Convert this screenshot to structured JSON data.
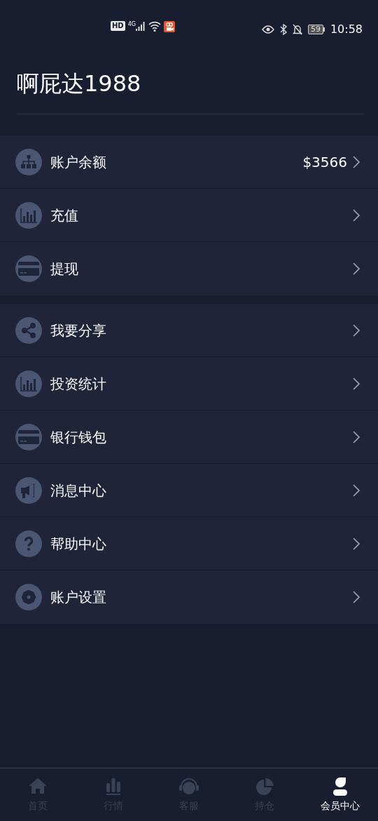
{
  "status_bar": {
    "hd_label": "HD",
    "network_label": "4G",
    "battery_label": "59",
    "time": "10:58"
  },
  "profile": {
    "username": "啊屁达1988"
  },
  "menu_groups": [
    {
      "items": [
        {
          "kind": "sitemap",
          "label": "账户余额",
          "value": "$3566"
        },
        {
          "kind": "chart",
          "label": "充值"
        },
        {
          "kind": "card",
          "label": "提现"
        }
      ]
    },
    {
      "items": [
        {
          "kind": "share",
          "label": "我要分享"
        },
        {
          "kind": "chart",
          "label": "投资统计"
        },
        {
          "kind": "card",
          "label": "银行钱包"
        },
        {
          "kind": "megaphone",
          "label": "消息中心"
        },
        {
          "kind": "help",
          "label": "帮助中心"
        },
        {
          "kind": "gear",
          "label": "账户设置"
        }
      ]
    }
  ],
  "bottom_nav": [
    {
      "kind": "home",
      "label": "首页",
      "selected": false
    },
    {
      "kind": "bars",
      "label": "行情",
      "selected": false
    },
    {
      "kind": "headset",
      "label": "客服",
      "selected": false
    },
    {
      "kind": "pie",
      "label": "持仓",
      "selected": false
    },
    {
      "kind": "person",
      "label": "会员中心",
      "selected": true
    }
  ]
}
